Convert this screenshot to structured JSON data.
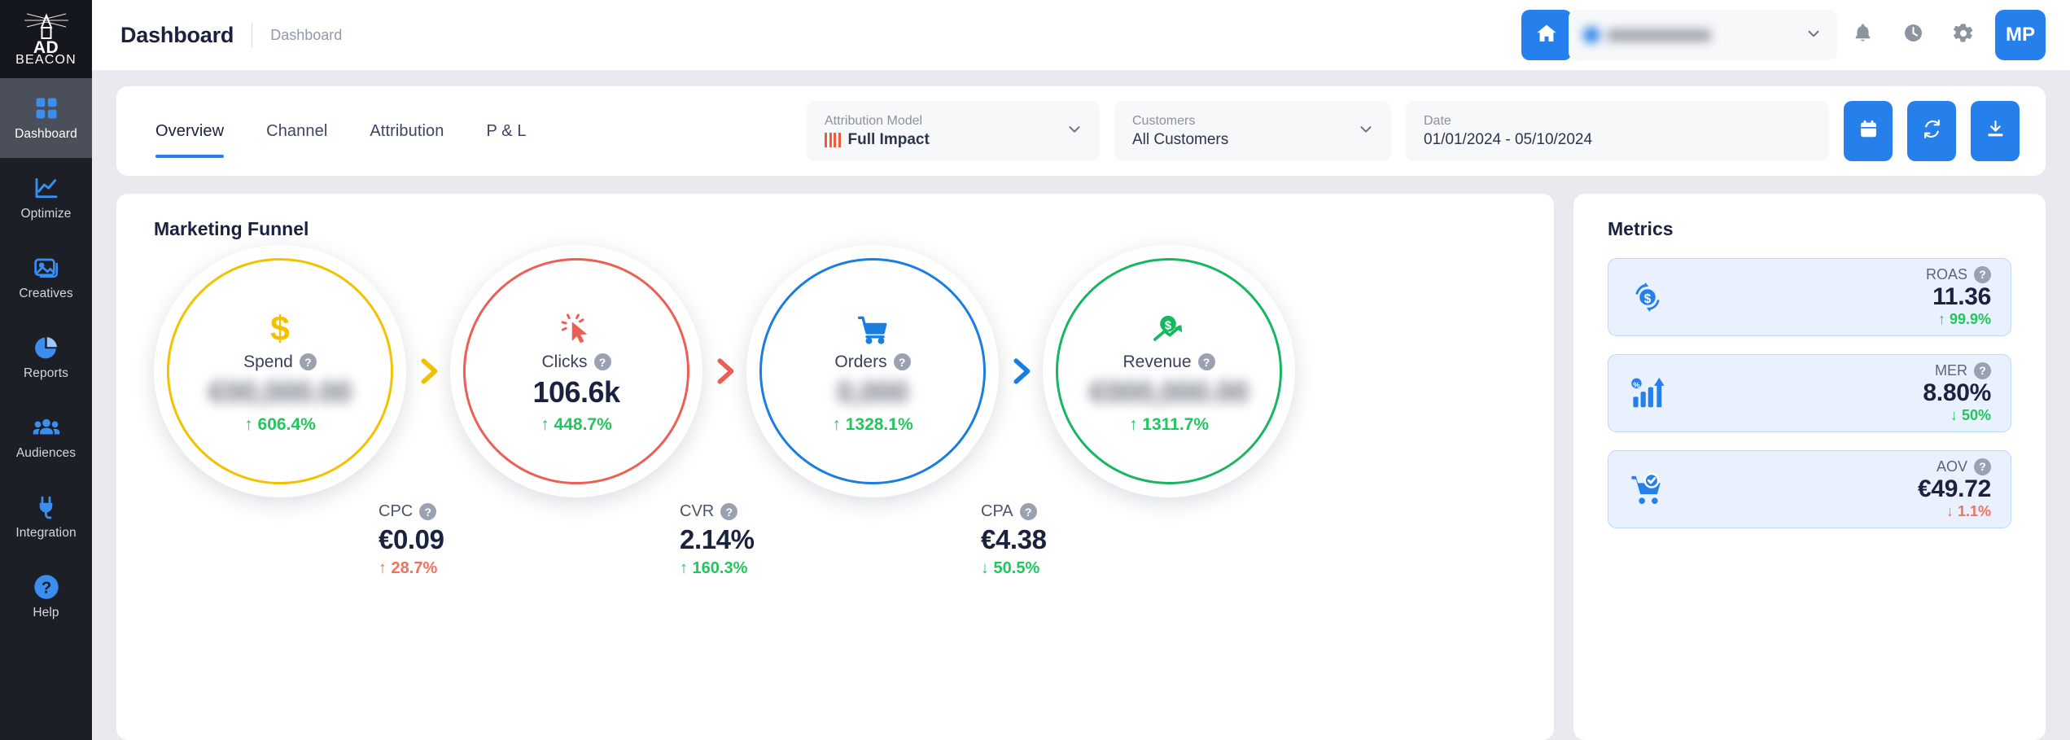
{
  "app": {
    "logo_line1": "AD",
    "logo_line2": "BEACON"
  },
  "sidebar": {
    "items": [
      {
        "label": "Dashboard",
        "icon": "grid-icon",
        "active": true
      },
      {
        "label": "Optimize",
        "icon": "line-chart-icon",
        "active": false
      },
      {
        "label": "Creatives",
        "icon": "image-icon",
        "active": false
      },
      {
        "label": "Reports",
        "icon": "pie-chart-icon",
        "active": false
      },
      {
        "label": "Audiences",
        "icon": "people-icon",
        "active": false
      },
      {
        "label": "Integration",
        "icon": "plug-icon",
        "active": false
      },
      {
        "label": "Help",
        "icon": "question-icon",
        "active": false
      }
    ]
  },
  "topbar": {
    "title": "Dashboard",
    "breadcrumb": "Dashboard",
    "home_icon": "home-icon",
    "account_selector_value": "",
    "notifications_icon": "bell-icon",
    "history_icon": "clock-icon",
    "settings_icon": "gear-icon",
    "avatar_initials": "MP"
  },
  "tabs": [
    {
      "label": "Overview",
      "active": true
    },
    {
      "label": "Channel",
      "active": false
    },
    {
      "label": "Attribution",
      "active": false
    },
    {
      "label": "P & L",
      "active": false
    }
  ],
  "filters": {
    "attribution": {
      "label": "Attribution Model",
      "value": "Full Impact"
    },
    "customers": {
      "label": "Customers",
      "value": "All Customers"
    },
    "date": {
      "label": "Date",
      "value": "01/01/2024 - 05/10/2024"
    },
    "buttons": [
      {
        "name": "calendar-button",
        "icon": "calendar-icon"
      },
      {
        "name": "refresh-button",
        "icon": "refresh-icon"
      },
      {
        "name": "download-button",
        "icon": "download-icon"
      }
    ]
  },
  "funnel": {
    "title": "Marketing Funnel",
    "stages": [
      {
        "label": "Spend",
        "value": "",
        "blurred": true,
        "delta": "↑ 606.4%",
        "delta_dir": "up",
        "delta_good": true,
        "color": "#f2c200",
        "icon": "dollar-icon"
      },
      {
        "label": "Clicks",
        "value": "106.6k",
        "blurred": false,
        "delta": "↑ 448.7%",
        "delta_dir": "up",
        "delta_good": true,
        "color": "#ec5f55",
        "icon": "cursor-click-icon"
      },
      {
        "label": "Orders",
        "value": "",
        "blurred": true,
        "delta": "↑ 1328.1%",
        "delta_dir": "up",
        "delta_good": true,
        "color": "#1a7ee0",
        "icon": "shopping-cart-icon"
      },
      {
        "label": "Revenue",
        "value": "",
        "blurred": true,
        "delta": "↑ 1311.7%",
        "delta_dir": "up",
        "delta_good": true,
        "color": "#16b760",
        "icon": "revenue-growth-icon"
      }
    ],
    "sub_metrics": [
      {
        "label": "CPC",
        "value": "€0.09",
        "delta": "↑ 28.7%",
        "delta_good": false
      },
      {
        "label": "CVR",
        "value": "2.14%",
        "delta": "↑ 160.3%",
        "delta_good": true
      },
      {
        "label": "CPA",
        "value": "€4.38",
        "delta": "↓ 50.5%",
        "delta_good": true
      }
    ]
  },
  "metrics": {
    "title": "Metrics",
    "items": [
      {
        "label": "ROAS",
        "value": "11.36",
        "delta": "↑ 99.9%",
        "delta_good": true,
        "icon": "roas-icon"
      },
      {
        "label": "MER",
        "value": "8.80%",
        "delta": "↓ 50%",
        "delta_good": true,
        "icon": "mer-bars-icon"
      },
      {
        "label": "AOV",
        "value": "€49.72",
        "delta": "↓ 1.1%",
        "delta_good": false,
        "icon": "cart-check-icon"
      }
    ]
  },
  "colors": {
    "accent": "#2680eb",
    "positive": "#22c55e",
    "negative": "#f1705f",
    "spend": "#f2c200",
    "clicks": "#ec5f55",
    "orders": "#1a7ee0",
    "revenue": "#16b760"
  }
}
